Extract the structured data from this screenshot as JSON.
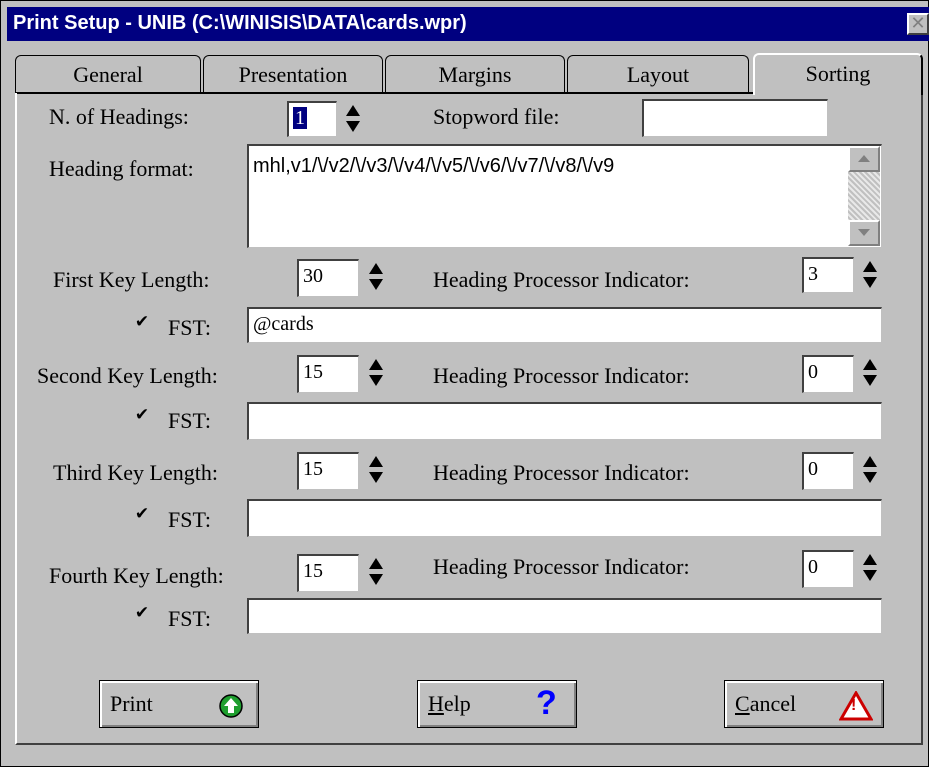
{
  "window": {
    "title": "Print Setup - UNIB (C:\\WINISIS\\DATA\\cards.wpr)",
    "close_glyph": "✕"
  },
  "tabs": [
    "General",
    "Presentation",
    "Margins",
    "Layout",
    "Sorting"
  ],
  "active_tab": "Sorting",
  "headings": {
    "label": "N. of Headings:",
    "value": "1"
  },
  "stopword": {
    "label": "Stopword file:",
    "value": ""
  },
  "heading_format": {
    "label": "Heading format:",
    "value": "mhl,v1/\\/v2/\\/v3/\\/v4/\\/v5/\\/v6/\\/v7/\\/v8/\\/v9"
  },
  "keys": [
    {
      "label": "First Key Length:",
      "length": "30",
      "hpi_label": "Heading Processor Indicator:",
      "hpi": "3",
      "fst_label": "FST:",
      "fst": "@cards",
      "fst_checked": true
    },
    {
      "label": "Second Key Length:",
      "length": "15",
      "hpi_label": "Heading Processor Indicator:",
      "hpi": "0",
      "fst_label": "FST:",
      "fst": "",
      "fst_checked": true
    },
    {
      "label": "Third Key Length:",
      "length": "15",
      "hpi_label": "Heading Processor Indicator:",
      "hpi": "0",
      "fst_label": "FST:",
      "fst": "",
      "fst_checked": true
    },
    {
      "label": "Fourth Key Length:",
      "length": "15",
      "hpi_label": "Heading Processor Indicator:",
      "hpi": "0",
      "fst_label": "FST:",
      "fst": "",
      "fst_checked": true
    }
  ],
  "checkbox_glyph": "✔",
  "buttons": {
    "print": {
      "label": "Print",
      "icon": "green-arrow-up-icon"
    },
    "help": {
      "label": "Help",
      "mnemonic": "H",
      "rest": "elp",
      "icon": "question-icon",
      "glyph": "?"
    },
    "cancel": {
      "label": "Cancel",
      "mnemonic": "C",
      "rest": "ancel",
      "icon": "warning-icon",
      "glyph": "!"
    }
  },
  "colors": {
    "title_bar": "#000080",
    "face": "#c0c0c0",
    "print_icon": "#1e9e2e",
    "help_icon": "#0000ff",
    "cancel_icon": "#cc0000"
  }
}
